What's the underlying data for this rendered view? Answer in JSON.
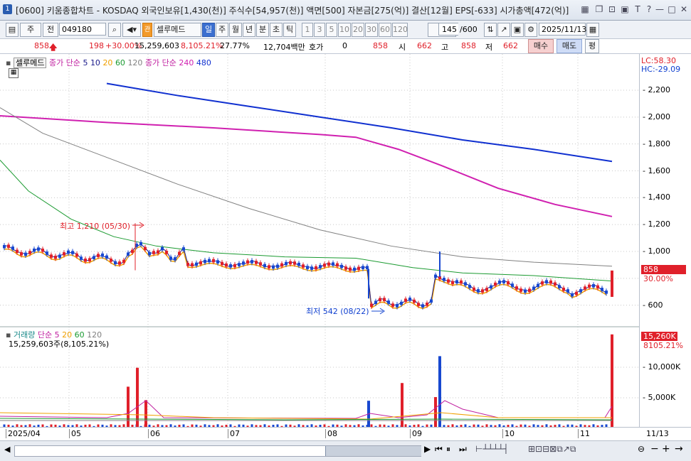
{
  "window": {
    "badge": "1",
    "title": "[0600] 키움종합차트 - KOSDAQ 외국인보유[1,430(천)] 주식수[54,957(천)] 액면[500] 자본금[275(억)] 결산[12월] EPS[-633] 시가총액[472(억)]"
  },
  "toolbar": {
    "stock_code": "049180",
    "stock_name": "셀루메드",
    "mode1": "주",
    "mode2": "전",
    "period_tabs": [
      "일",
      "주",
      "월",
      "년",
      "분",
      "초",
      "틱"
    ],
    "interval_buttons": [
      "1",
      "3",
      "5",
      "10",
      "20",
      "30",
      "60",
      "120"
    ],
    "count": "145",
    "count_total": "/600",
    "date": "2025/11/13"
  },
  "quote": {
    "price": "858",
    "change": "198",
    "change_pct": "+30.00%",
    "volume": "15,259,603",
    "volume_pct": "8,105.21%",
    "turnover": "27.77%",
    "amount": "12,704백만",
    "hoga_label": "호가",
    "hoga_value": "0",
    "hoga_price": "858",
    "open_label": "시",
    "open": "662",
    "high_label": "고",
    "high": "858",
    "low_label": "저",
    "low": "662",
    "buy_label": "매수",
    "sell_label": "매도",
    "flat_label": "평"
  },
  "price_legend": {
    "name": "셀루메드",
    "ma_label": "종가 단순",
    "ma_periods": [
      "5",
      "10",
      "20",
      "60",
      "120"
    ],
    "ma_label2": "종가 단순",
    "ma_periods2": [
      "240",
      "480"
    ],
    "lc": "LC:58.30",
    "hc": "HC:-29.09"
  },
  "volume_legend": {
    "name": "거래량",
    "ma_label": "단순",
    "ma_periods": [
      "5",
      "20",
      "60",
      "120"
    ],
    "value": "15,259,603주(8,105.21%)"
  },
  "annotations": {
    "high": "최고 1,210 (05/30)",
    "low": "최저 542 (08/22)"
  },
  "price_axis": {
    "ticks": [
      "2,200",
      "2,000",
      "1,800",
      "1,600",
      "1,400",
      "1,200",
      "1,000",
      "600"
    ],
    "last_price": "858",
    "last_pct": "30.00%"
  },
  "volume_axis": {
    "ticks": [
      "10,000K",
      "5,000K"
    ],
    "last_volume": "15,260K",
    "last_pct": "8105.21%"
  },
  "time_axis": {
    "labels": [
      "2025/04",
      "05",
      "06",
      "07",
      "08",
      "09",
      "10",
      "11",
      "11/13"
    ]
  },
  "colors": {
    "up": "#e0202a",
    "down": "#1848d0",
    "ma5": "#1a1a8a",
    "ma20": "#f0a000",
    "ma60": "#1a9a30",
    "ma120": "#808080",
    "ma240": "#d020b0",
    "ma480": "#1030d0"
  },
  "chart_data": {
    "type": "candlestick",
    "ylim": [
      500,
      2300
    ],
    "ma240": [
      [
        0,
        2010
      ],
      [
        150,
        1960
      ],
      [
        300,
        1920
      ],
      [
        450,
        1870
      ],
      [
        500,
        1850
      ],
      [
        560,
        1760
      ],
      [
        620,
        1640
      ],
      [
        700,
        1470
      ],
      [
        780,
        1350
      ],
      [
        860,
        1260
      ]
    ],
    "ma480": [
      [
        150,
        2250
      ],
      [
        250,
        2160
      ],
      [
        350,
        2080
      ],
      [
        450,
        2000
      ],
      [
        550,
        1920
      ],
      [
        650,
        1830
      ],
      [
        750,
        1760
      ],
      [
        860,
        1670
      ]
    ],
    "ma120": [
      [
        0,
        2070
      ],
      [
        60,
        1880
      ],
      [
        150,
        1700
      ],
      [
        250,
        1500
      ],
      [
        350,
        1320
      ],
      [
        450,
        1160
      ],
      [
        550,
        1040
      ],
      [
        650,
        960
      ],
      [
        750,
        920
      ],
      [
        860,
        890
      ]
    ],
    "ma60": [
      [
        0,
        1680
      ],
      [
        40,
        1450
      ],
      [
        100,
        1240
      ],
      [
        160,
        1110
      ],
      [
        220,
        1040
      ],
      [
        300,
        990
      ],
      [
        400,
        960
      ],
      [
        500,
        950
      ],
      [
        580,
        880
      ],
      [
        650,
        840
      ],
      [
        750,
        820
      ],
      [
        860,
        780
      ]
    ],
    "volume_spikes": [
      [
        180,
        6700000,
        "up"
      ],
      [
        193,
        9800000,
        "up"
      ],
      [
        205,
        4500000,
        "up"
      ],
      [
        518,
        4400000,
        "down"
      ],
      [
        565,
        7300000,
        "up"
      ],
      [
        612,
        5000000,
        "up"
      ],
      [
        618,
        11700000,
        "down"
      ],
      [
        860,
        15259603,
        "up"
      ]
    ]
  }
}
